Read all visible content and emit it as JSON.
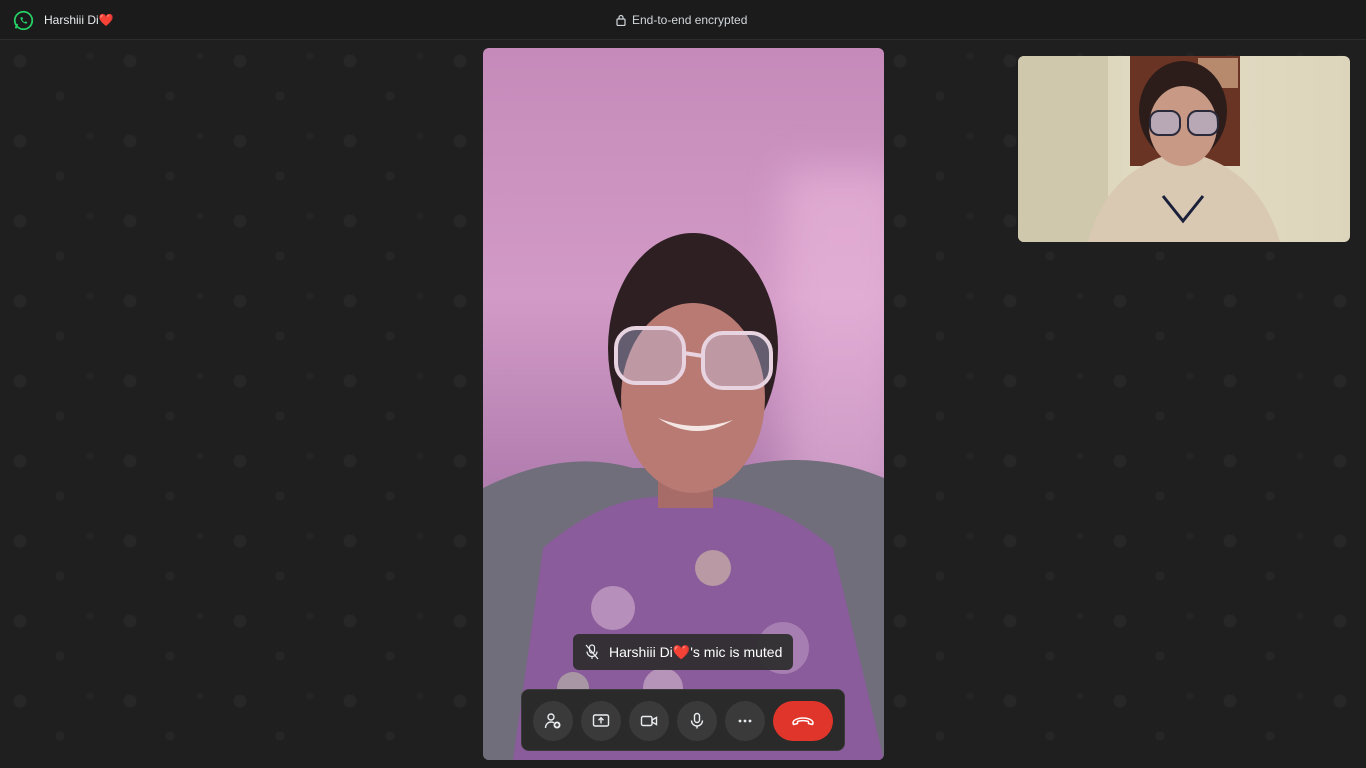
{
  "window": {
    "app_icon": "whatsapp-logo-icon",
    "contact_name": "Harshiii Di❤️",
    "encryption_label": "End-to-end encrypted",
    "encryption_icon": "lock-icon"
  },
  "call": {
    "mute_notice": "Harshiii Di❤️'s mic is muted",
    "mute_icon": "mic-off-icon"
  },
  "controls": [
    {
      "name": "add-participant",
      "icon": "add-person-icon"
    },
    {
      "name": "share-screen",
      "icon": "share-screen-icon"
    },
    {
      "name": "video-toggle",
      "icon": "video-camera-icon"
    },
    {
      "name": "mic-toggle",
      "icon": "microphone-icon"
    },
    {
      "name": "more-options",
      "icon": "more-horizontal-icon"
    },
    {
      "name": "end-call",
      "icon": "end-call-icon"
    }
  ],
  "colors": {
    "brand_green": "#25d366",
    "end_call_red": "#e0352b",
    "background": "#1f1f1f"
  }
}
